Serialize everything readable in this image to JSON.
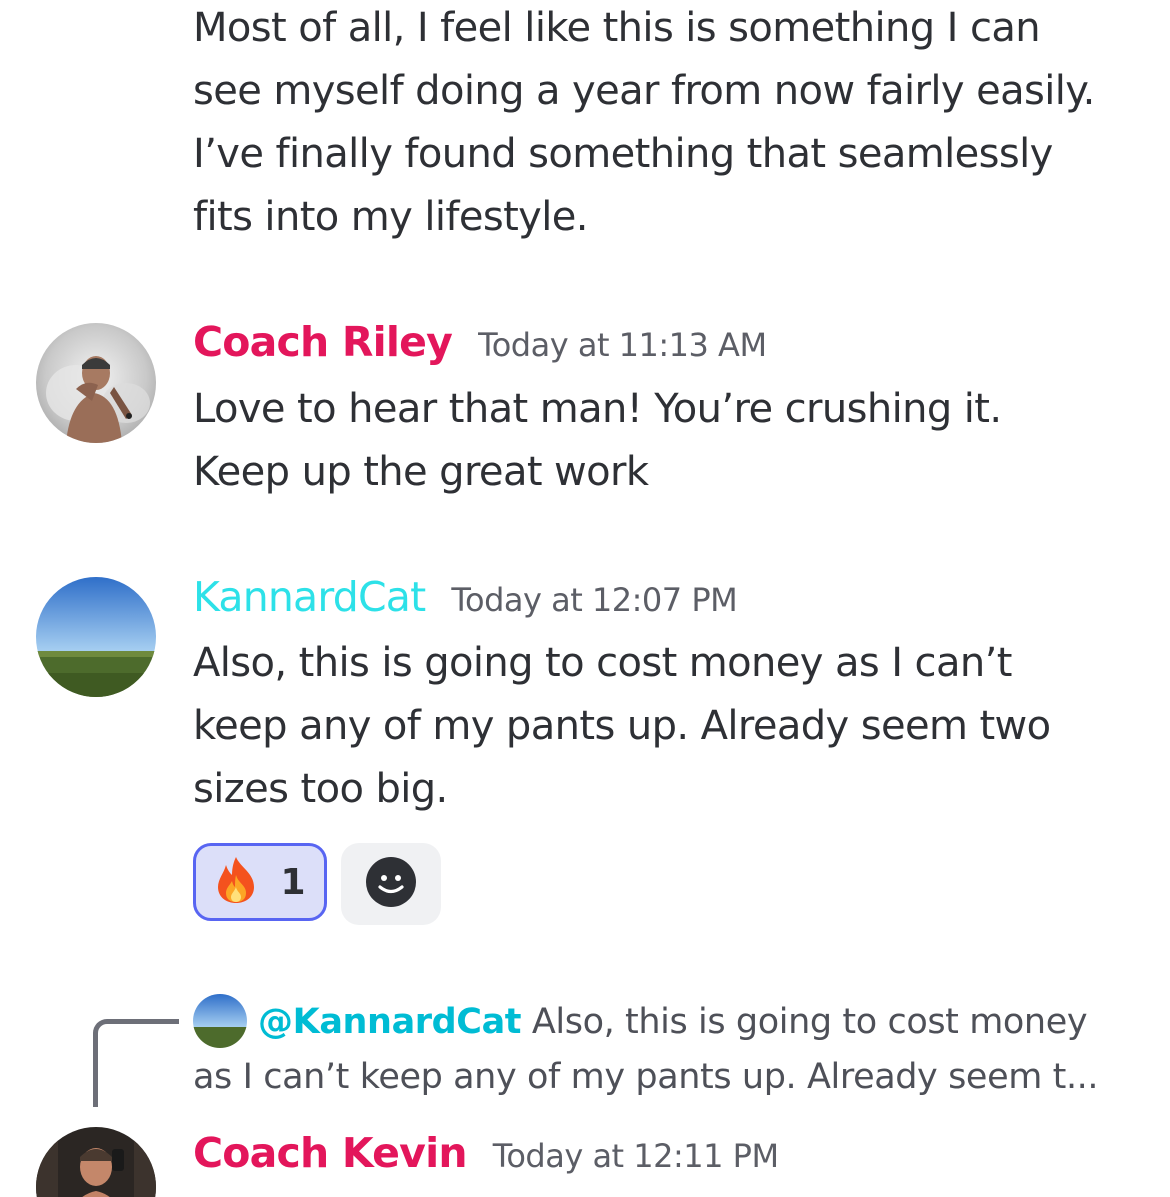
{
  "messages": {
    "intro": {
      "lines": [
        "Most of all, I feel like this is something I can",
        "see myself doing a year from now fairly easily.",
        "I’ve finally found something that seamlessly",
        "fits into my lifestyle."
      ]
    },
    "riley": {
      "username": "Coach Riley",
      "timestamp": "Today at 11:13 AM",
      "lines": [
        "Love to hear that man! You’re crushing it.",
        "Keep up the great work"
      ]
    },
    "kannard": {
      "username": "KannardCat",
      "timestamp": "Today at 12:07 PM",
      "lines": [
        "Also, this is going to cost money as I can’t",
        "keep any of my pants up. Already seem two",
        "sizes too big."
      ],
      "reaction": {
        "emoji": "🔥",
        "count": "1"
      }
    },
    "reply": {
      "mention": "@KannardCat",
      "line1": "Also, this is going to cost money",
      "line2": "as I can’t keep any of my pants up. Already seem t..."
    },
    "kevin": {
      "username": "Coach Kevin",
      "timestamp": "Today at 12:11 PM"
    }
  },
  "colors": {
    "coach_name": "#e3165b",
    "kannard_name": "#2de1e8",
    "mention": "#00bcd4",
    "reaction_border": "#5865f2",
    "reaction_bg": "#dcdff9"
  },
  "icons": {
    "add_reaction": "smiley-face-icon",
    "reaction": "fire-emoji-icon"
  }
}
